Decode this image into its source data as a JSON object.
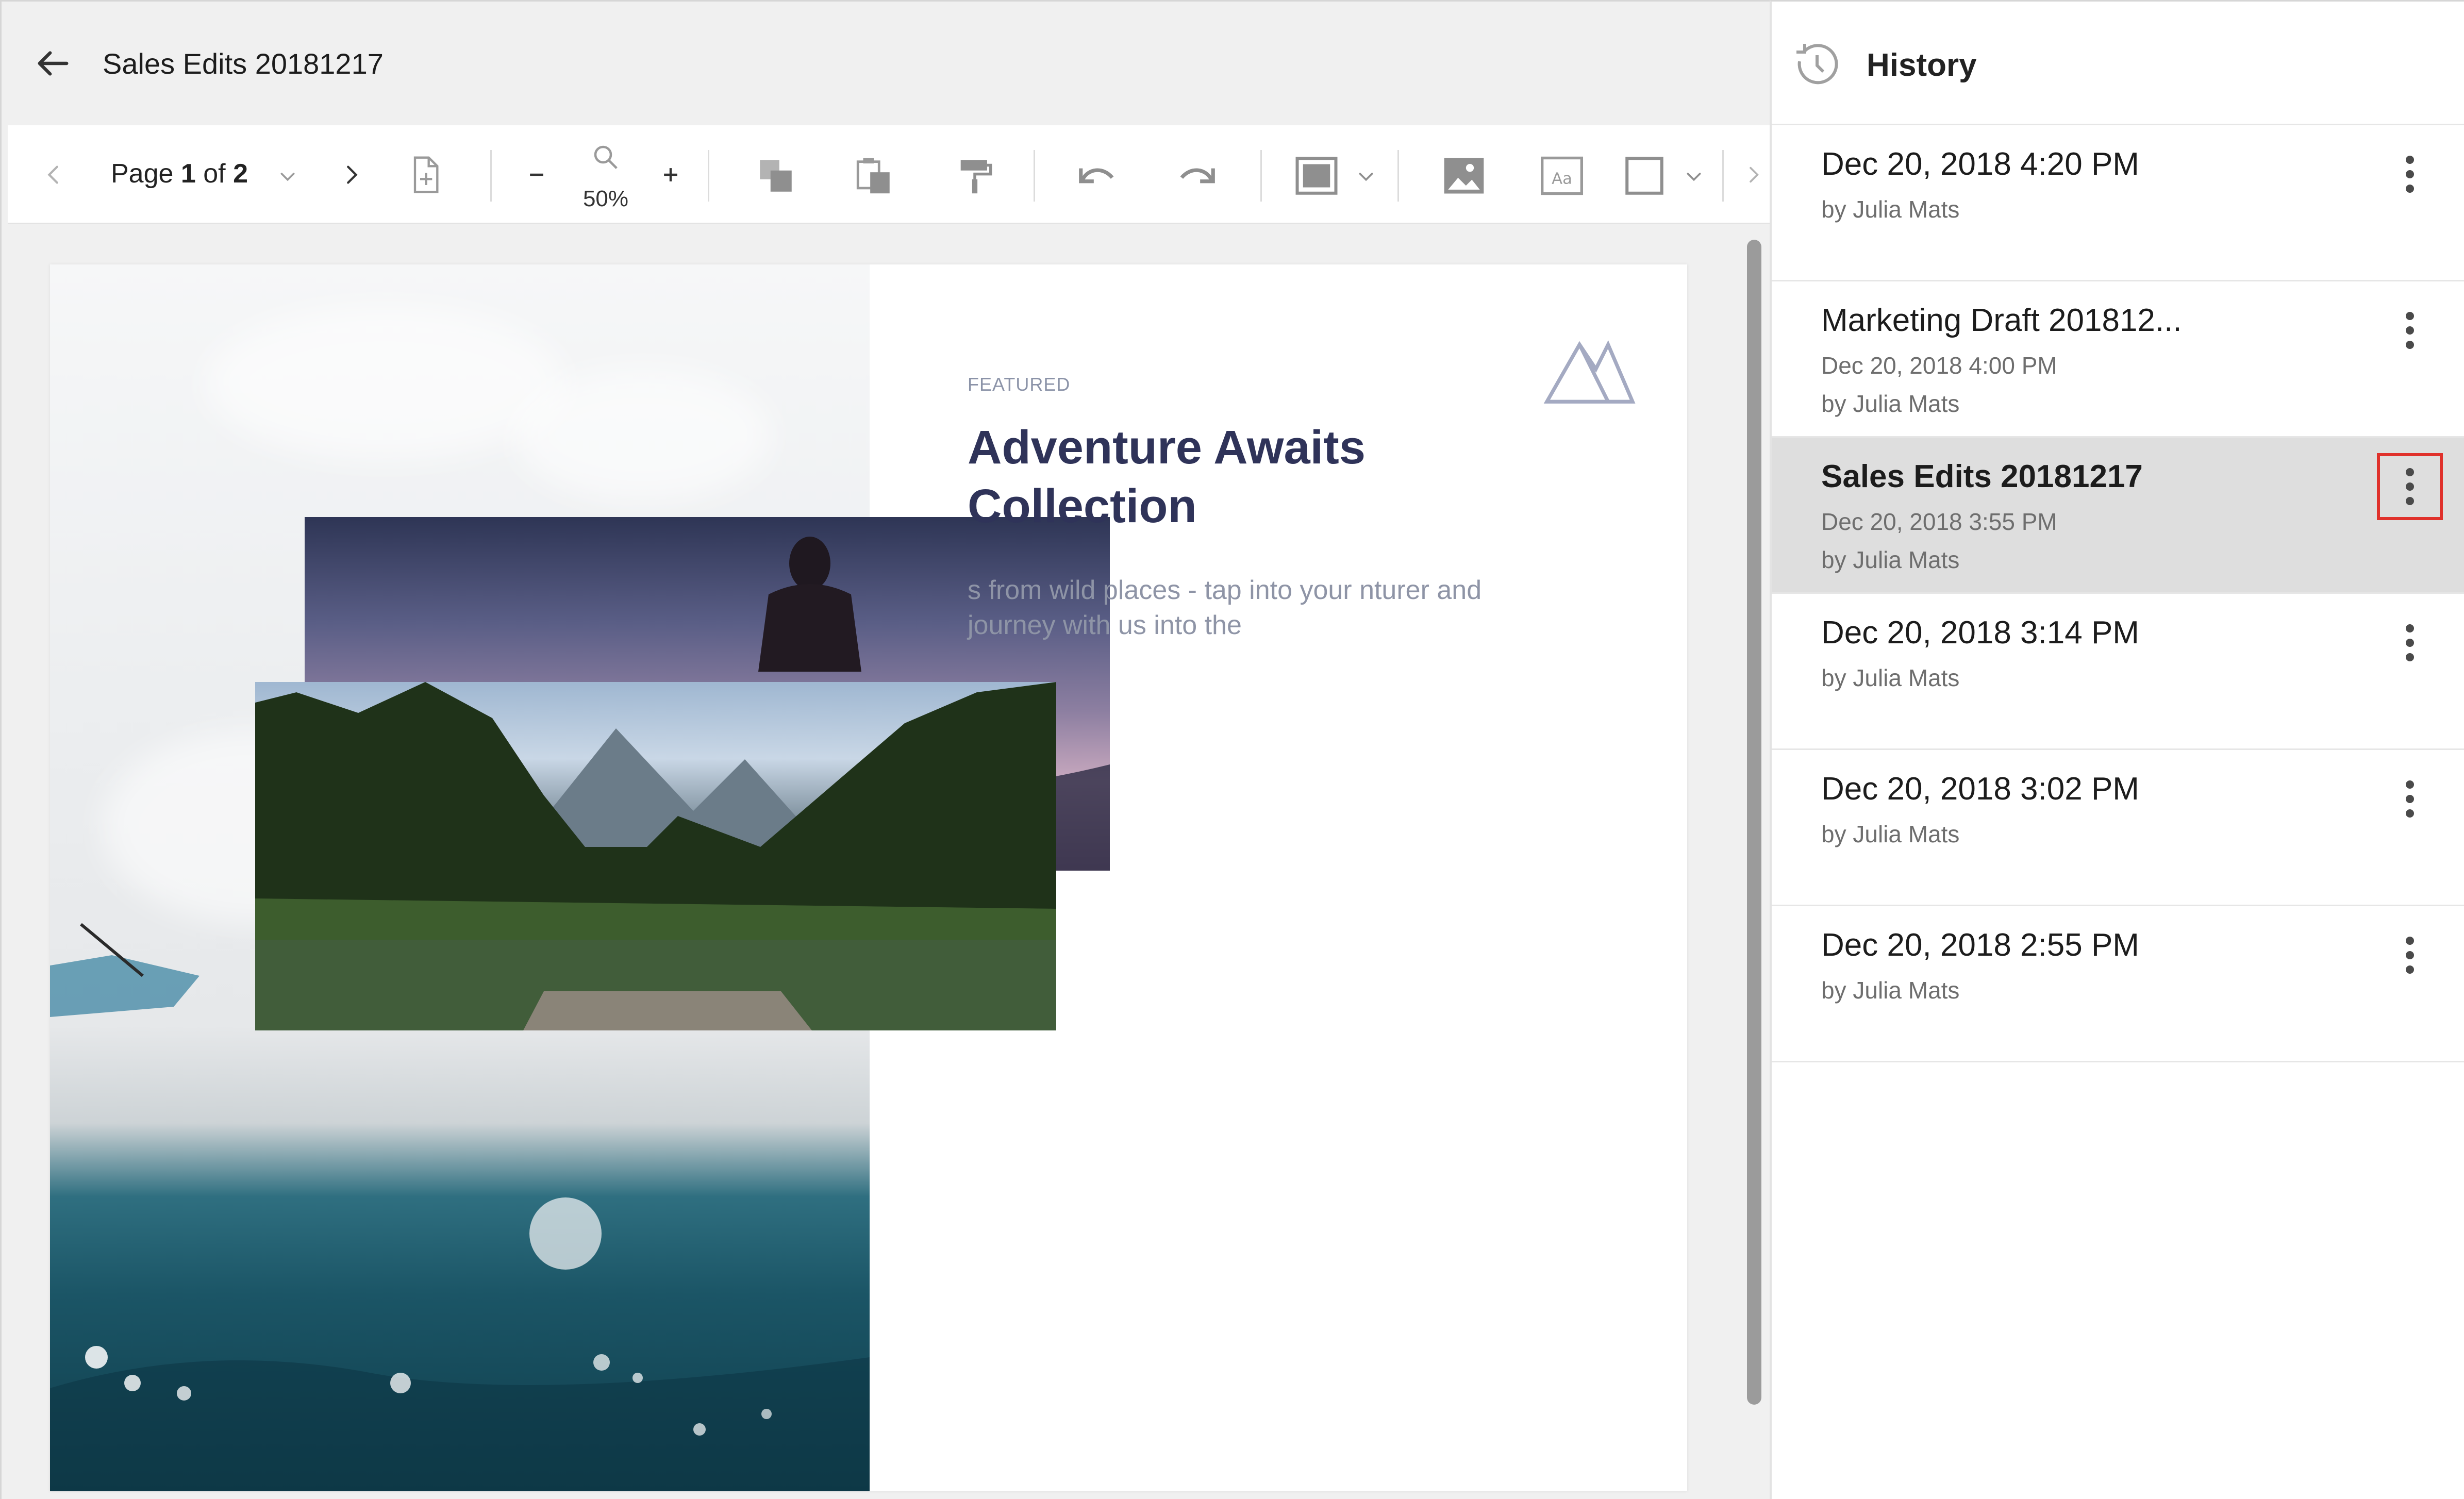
{
  "document": {
    "title": "Sales Edits 20181217"
  },
  "toolbar": {
    "page_prefix": "Page ",
    "page_current": "1",
    "page_of": " of ",
    "page_total": "2",
    "zoom": "50%"
  },
  "page_content": {
    "featured": "FEATURED",
    "heading": "Adventure Awaits Collection",
    "body": "s from wild places - tap into your nturer and journey with us into the"
  },
  "history": {
    "title": "History",
    "items": [
      {
        "title": "Dec 20, 2018 4:20 PM",
        "date": "",
        "author": "by Julia Mats"
      },
      {
        "title": "Marketing Draft 201812...",
        "date": "Dec 20, 2018 4:00 PM",
        "author": "by Julia Mats"
      },
      {
        "title": "Sales Edits 20181217",
        "date": "Dec 20, 2018 3:55 PM",
        "author": "by Julia Mats"
      },
      {
        "title": "Dec 20, 2018 3:14 PM",
        "date": "",
        "author": "by Julia Mats"
      },
      {
        "title": "Dec 20, 2018 3:02 PM",
        "date": "",
        "author": "by Julia Mats"
      },
      {
        "title": "Dec 20, 2018 2:55 PM",
        "date": "",
        "author": "by Julia Mats"
      }
    ]
  },
  "colors": {
    "heading": "#2f3359",
    "selected_row": "#dedede",
    "highlight_border": "#e0312b"
  }
}
